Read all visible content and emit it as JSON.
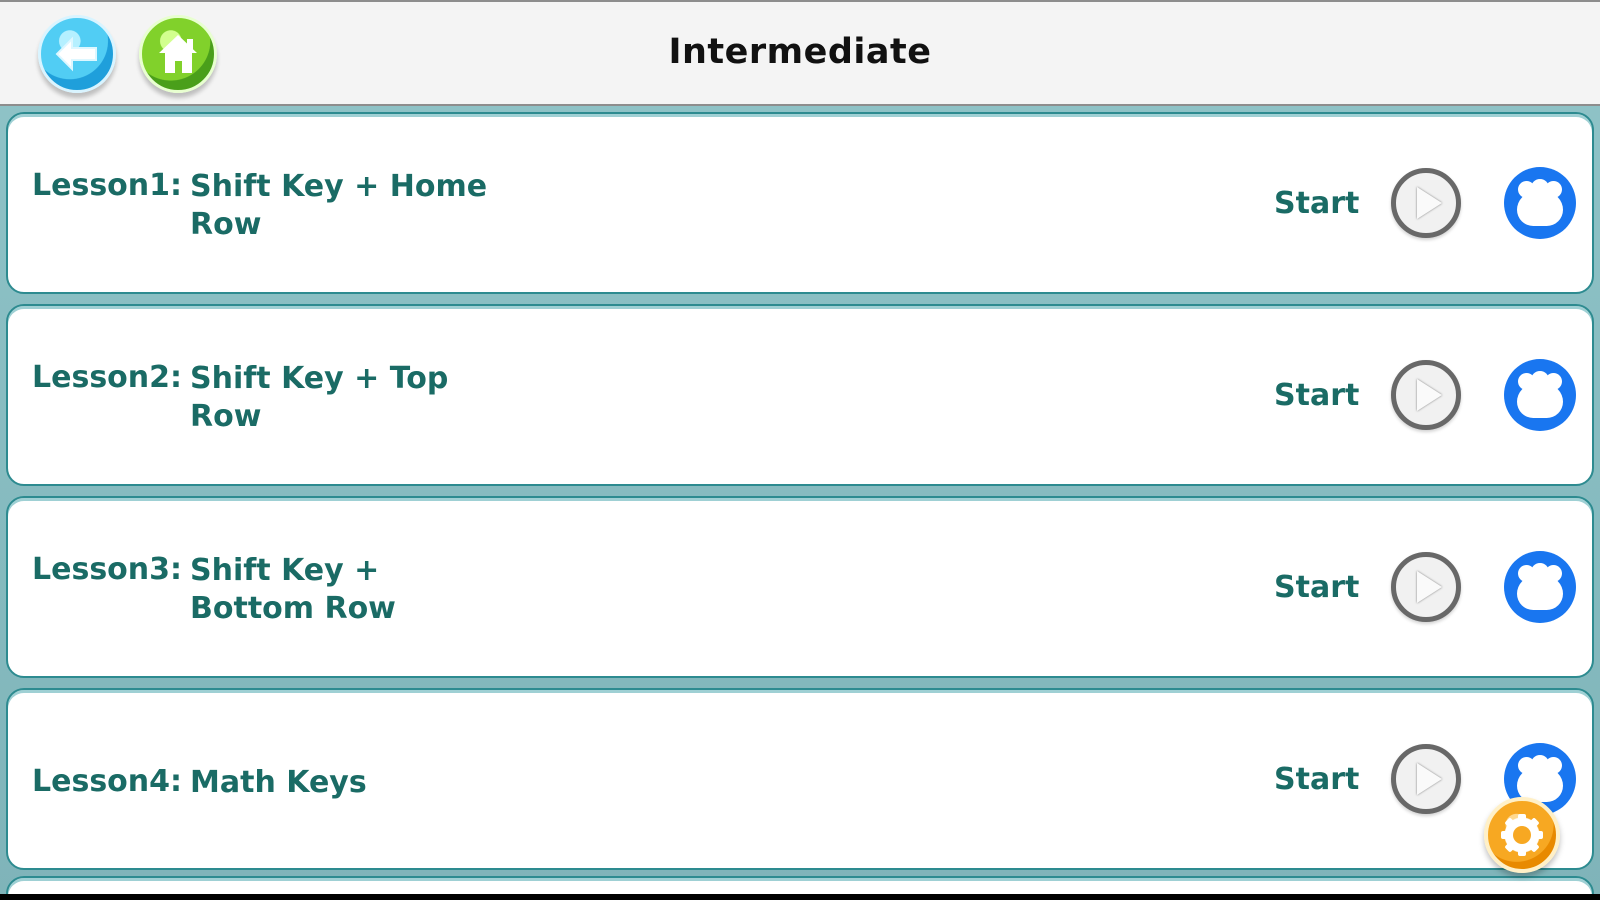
{
  "header": {
    "title": "Intermediate",
    "back_icon": "back-arrow-icon",
    "home_icon": "home-icon"
  },
  "lessons": [
    {
      "number": "Lesson1:",
      "title": "Shift Key + Home Row",
      "action": "Start",
      "play_icon": "play-icon",
      "group_icon": "users-icon"
    },
    {
      "number": "Lesson2:",
      "title": "Shift Key + Top Row",
      "action": "Start",
      "play_icon": "play-icon",
      "group_icon": "users-icon"
    },
    {
      "number": "Lesson3:",
      "title": "Shift Key + Bottom Row",
      "action": "Start",
      "play_icon": "play-icon",
      "group_icon": "users-icon"
    },
    {
      "number": "Lesson4:",
      "title": "Math Keys",
      "action": "Start",
      "play_icon": "play-icon",
      "group_icon": "users-icon"
    }
  ],
  "floating_action": {
    "icon": "gear-icon"
  },
  "colors": {
    "lesson_text": "#1a6b65",
    "card_border": "#2d8b90",
    "background": "#8cc2c6",
    "group_button": "#1976f0",
    "settings_button": "#f7a822"
  }
}
